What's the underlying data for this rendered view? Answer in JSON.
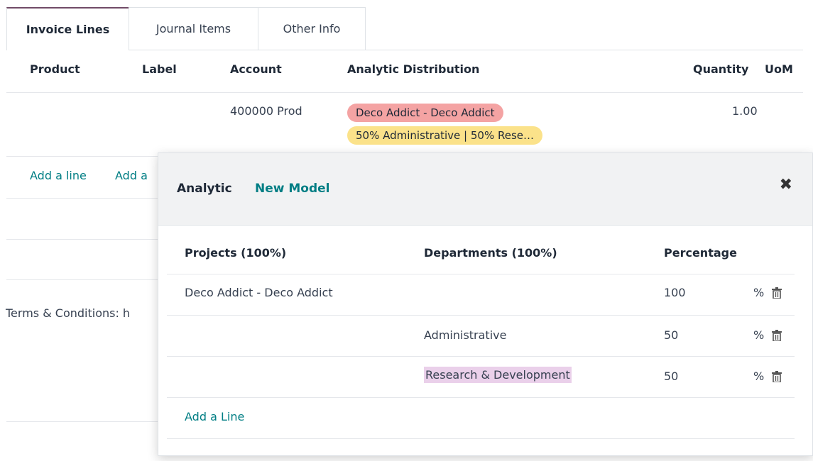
{
  "tabs": [
    {
      "label": "Invoice Lines",
      "active": true
    },
    {
      "label": "Journal Items",
      "active": false
    },
    {
      "label": "Other Info",
      "active": false
    }
  ],
  "table": {
    "headers": [
      "Product",
      "Label",
      "Account",
      "Analytic Distribution",
      "Quantity",
      "UoM"
    ],
    "row": {
      "account": "400000 Prod",
      "tags": [
        {
          "text": "Deco Addict - Deco Addict",
          "color": "#f4a3a3"
        },
        {
          "text": "50% Administrative | 50% Rese…",
          "color": "#fbe28a"
        }
      ],
      "quantity": "1.00"
    },
    "add_line": "Add a line",
    "add_section_partial": "Add a",
    "terms_partial": "Terms & Conditions: h"
  },
  "popover": {
    "title": "Analytic",
    "new_model": "New Model",
    "close_icon": "close-icon",
    "headers": [
      "Projects (100%)",
      "Departments (100%)",
      "Percentage"
    ],
    "rows": [
      {
        "project": "Deco Addict - Deco Addict",
        "department": "",
        "percentage": "100",
        "unit": "%"
      },
      {
        "project": "",
        "department": "Administrative",
        "percentage": "50",
        "unit": "%"
      },
      {
        "project": "",
        "department": "Research & Development",
        "percentage": "50",
        "unit": "%"
      }
    ],
    "add_line": "Add a Line"
  },
  "colors": {
    "accent": "#017e84",
    "brand": "#714b67",
    "highlight": "#ead0ea"
  }
}
